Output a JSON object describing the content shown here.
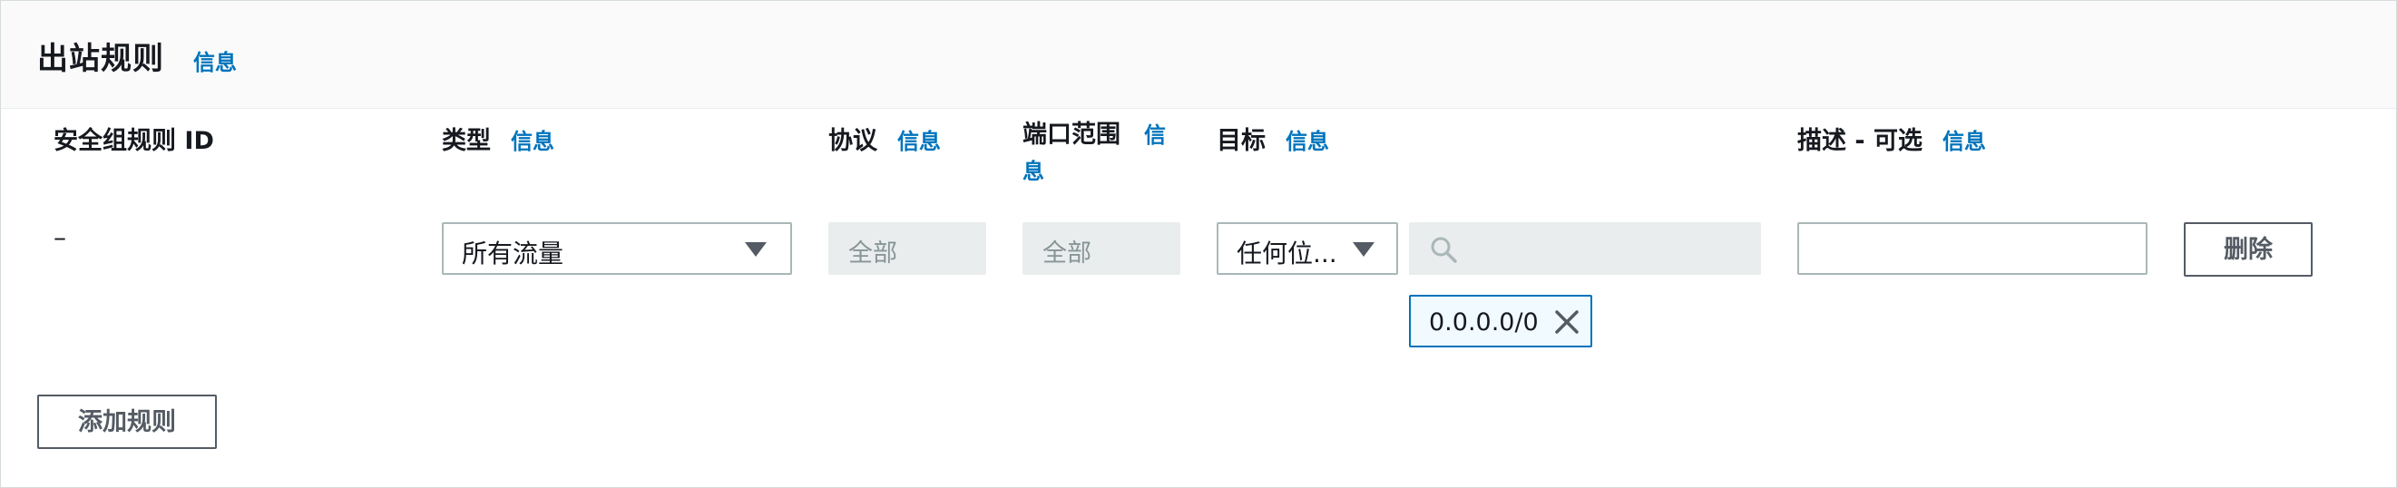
{
  "panel": {
    "title": "出站规则",
    "info_label": "信息"
  },
  "columns": {
    "rule_id": "安全组规则 ID",
    "type": "类型",
    "protocol": "协议",
    "port_range": "端口范围",
    "destination": "目标",
    "description": "描述 - 可选",
    "info_label": "信息"
  },
  "rule": {
    "id": "–",
    "type_value": "所有流量",
    "protocol_value": "全部",
    "port_value": "全部",
    "destination_type": "任何位...",
    "destination_search_placeholder": "",
    "destination_token": "0.0.0.0/0",
    "description_value": "",
    "delete_label": "删除"
  },
  "actions": {
    "add_rule_label": "添加规则"
  },
  "icons": {
    "caret": "caret-down-icon",
    "search": "search-icon",
    "close": "close-icon"
  },
  "colors": {
    "link": "#0073bb",
    "header_bg": "#fafafa",
    "disabled_bg": "#eaeded",
    "border": "#aab7b8",
    "token_border": "#0073bb"
  }
}
